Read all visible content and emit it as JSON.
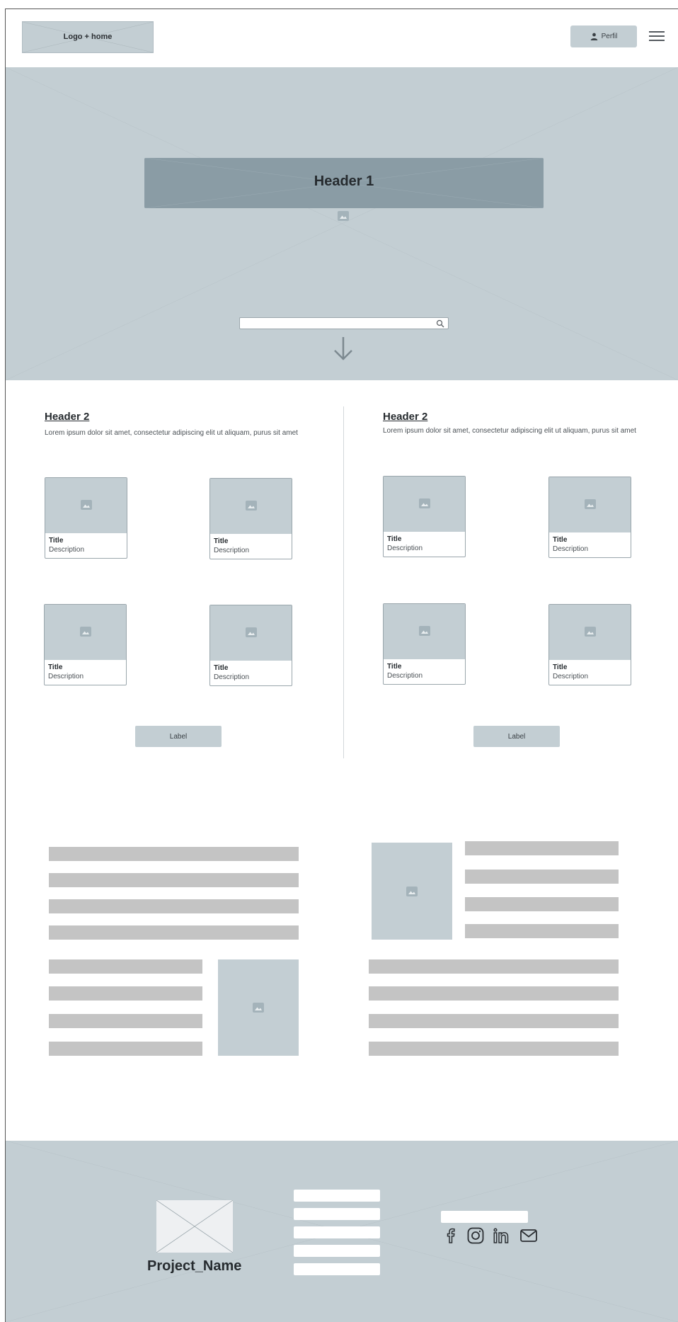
{
  "nav": {
    "logo_label": "Logo + home",
    "profile_label": "Perfil"
  },
  "hero": {
    "title": "Header 1",
    "search_placeholder": ""
  },
  "sections": [
    {
      "heading": "Header 2",
      "text": "Lorem ipsum dolor sit amet, consectetur adipiscing elit ut aliquam, purus sit amet",
      "cards": [
        {
          "title": "Title",
          "description": "Description"
        },
        {
          "title": "Title",
          "description": "Description"
        },
        {
          "title": "Title",
          "description": "Description"
        },
        {
          "title": "Title",
          "description": "Description"
        }
      ],
      "button_label": "Label"
    },
    {
      "heading": "Header 2",
      "text": "Lorem ipsum dolor sit amet, consectetur adipiscing elit ut aliquam, purus sit amet",
      "cards": [
        {
          "title": "Title",
          "description": "Description"
        },
        {
          "title": "Title",
          "description": "Description"
        },
        {
          "title": "Title",
          "description": "Description"
        },
        {
          "title": "Title",
          "description": "Description"
        }
      ],
      "button_label": "Label"
    }
  ],
  "footer": {
    "project_name": "Project_Name",
    "social_icons": [
      "facebook-icon",
      "instagram-icon",
      "linkedin-icon",
      "mail-icon"
    ]
  },
  "colors": {
    "wireframe_fill": "#c3ced3",
    "header_fill": "#8a9ca5",
    "text_line": "#c4c4c4"
  }
}
